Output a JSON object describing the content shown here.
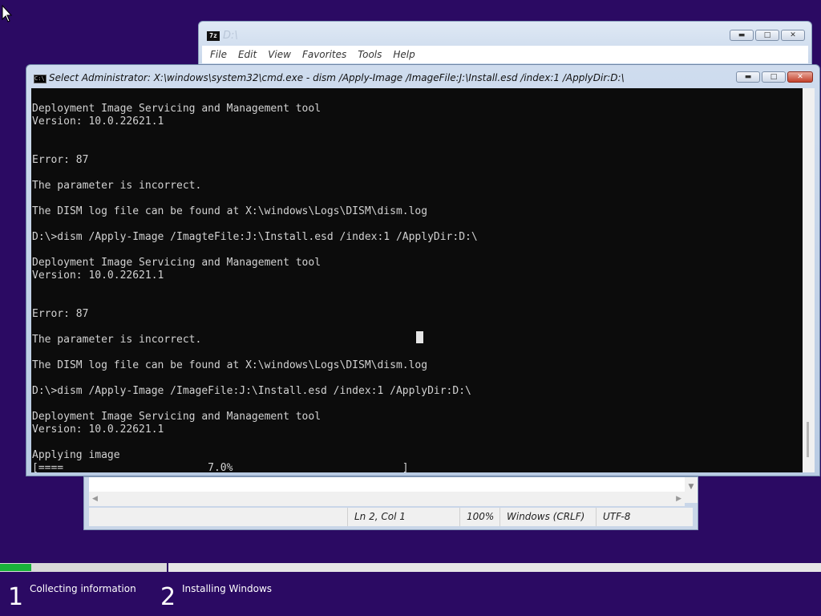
{
  "sevenzip": {
    "app_icon": "7z",
    "title": "D:\\",
    "menu": [
      "File",
      "Edit",
      "View",
      "Favorites",
      "Tools",
      "Help"
    ]
  },
  "cmd": {
    "title": "Select Administrator: X:\\windows\\system32\\cmd.exe - dism  /Apply-Image /ImageFile:J:\\Install.esd /index:1 /ApplyDir:D:\\",
    "app_icon": "C:\\",
    "console_lines": [
      "Deployment Image Servicing and Management tool",
      "Version: 10.0.22621.1",
      "",
      "",
      "Error: 87",
      "",
      "The parameter is incorrect.",
      "",
      "The DISM log file can be found at X:\\windows\\Logs\\DISM\\dism.log",
      "",
      "D:\\>dism /Apply-Image /ImagteFile:J:\\Install.esd /index:1 /ApplyDir:D:\\",
      "",
      "Deployment Image Servicing and Management tool",
      "Version: 10.0.22621.1",
      "",
      "",
      "Error: 87",
      "",
      "The parameter is incorrect.",
      "",
      "The DISM log file can be found at X:\\windows\\Logs\\DISM\\dism.log",
      "",
      "D:\\>dism /Apply-Image /ImageFile:J:\\Install.esd /index:1 /ApplyDir:D:\\",
      "",
      "Deployment Image Servicing and Management tool",
      "Version: 10.0.22621.1",
      "",
      "Applying image",
      "[====                       7.0%                           ]"
    ]
  },
  "notepad": {
    "status": {
      "position": "Ln 2, Col 1",
      "zoom": "100%",
      "line_ending": "Windows (CRLF)",
      "encoding": "UTF-8"
    }
  },
  "setup": {
    "progress_fraction": 0.038,
    "steps": [
      {
        "number": "1",
        "label": "Collecting information"
      },
      {
        "number": "2",
        "label": "Installing Windows"
      }
    ]
  },
  "icons": {
    "cursor": "mouse-pointer-icon",
    "minimize": "minimize-icon",
    "maximize": "maximize-icon",
    "close": "close-icon"
  }
}
